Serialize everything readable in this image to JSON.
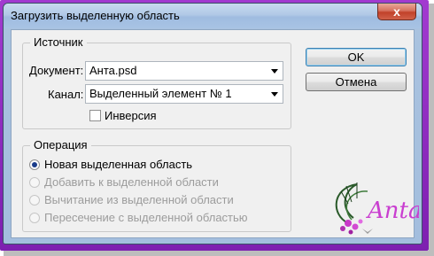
{
  "window": {
    "title": "Загрузить выделенную область",
    "close_symbol": "x"
  },
  "source": {
    "legend": "Источник",
    "document_label": "Документ:",
    "document_value": "Анта.psd",
    "channel_label": "Канал:",
    "channel_value": "Выделенный элемент № 1",
    "invert_label": "Инверсия",
    "invert_checked": false
  },
  "operation": {
    "legend": "Операция",
    "options": [
      {
        "label": "Новая выделенная область",
        "selected": true,
        "enabled": true
      },
      {
        "label": "Добавить к выделенной области",
        "selected": false,
        "enabled": false
      },
      {
        "label": "Вычитание из выделенной области",
        "selected": false,
        "enabled": false
      },
      {
        "label": "Пересечение с выделенной областью",
        "selected": false,
        "enabled": false
      }
    ]
  },
  "buttons": {
    "ok": "OK",
    "cancel": "Отмена"
  },
  "watermark": {
    "text": "Anta"
  },
  "colors": {
    "frame": "#8f2bc4",
    "titlebar": "#b1c9e6",
    "close": "#c1412a",
    "dialog_bg": "#f0f0f0"
  }
}
